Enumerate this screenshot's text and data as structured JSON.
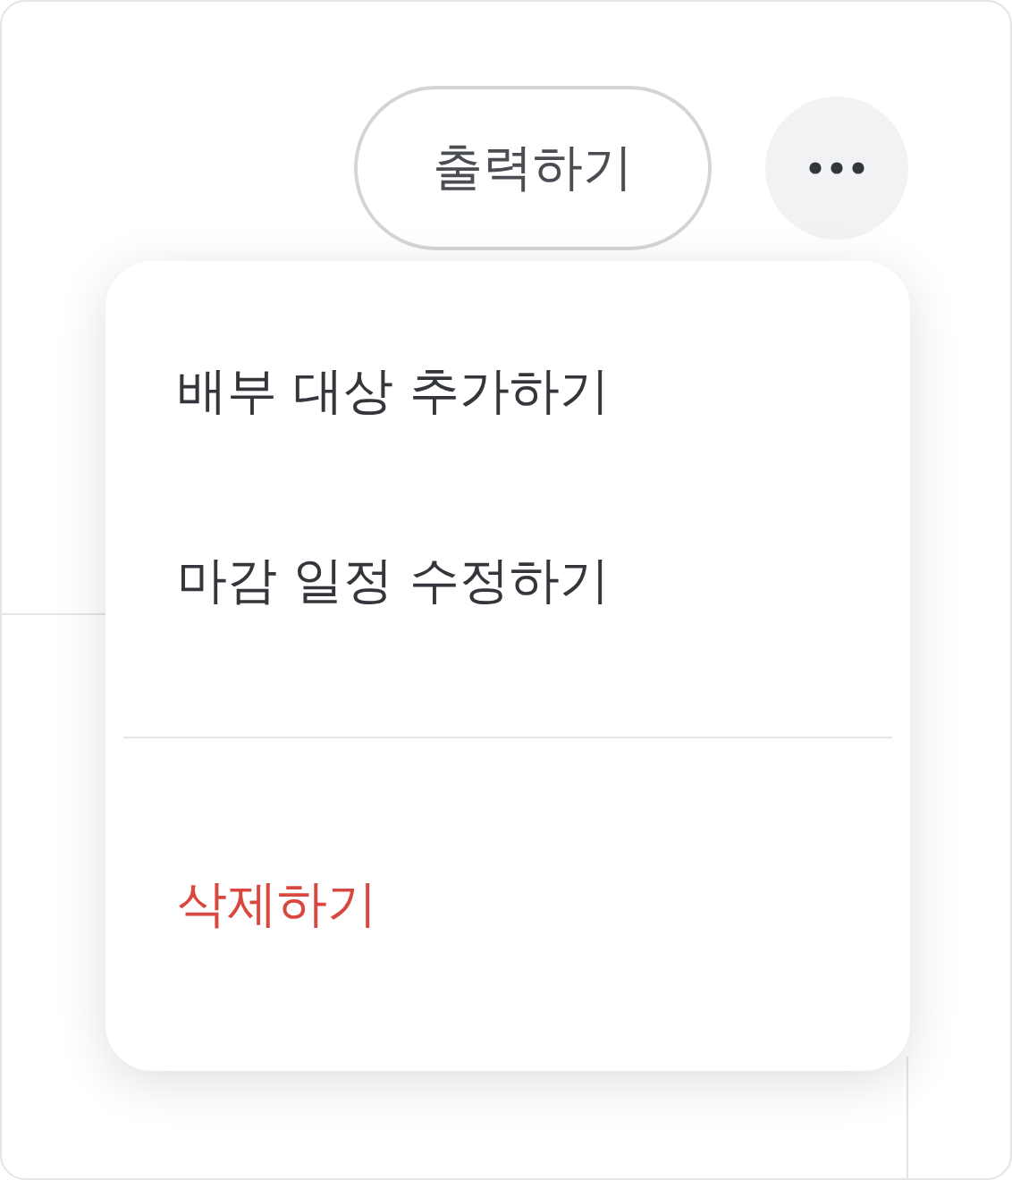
{
  "toolbar": {
    "print_button": {
      "label": "출력하기"
    }
  },
  "menu": {
    "sections": [
      {
        "items": [
          {
            "label": "배부 대상 추가하기",
            "kind": "normal"
          },
          {
            "label": "마감 일정 수정하기",
            "kind": "normal"
          }
        ]
      },
      {
        "items": [
          {
            "label": "삭제하기",
            "kind": "danger"
          }
        ]
      }
    ]
  }
}
